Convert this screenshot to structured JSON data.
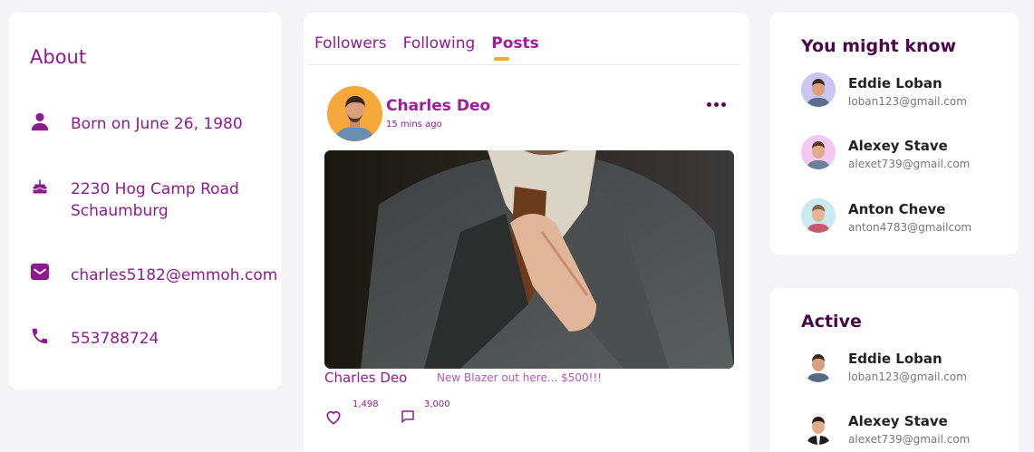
{
  "about": {
    "title": "About",
    "items": [
      {
        "icon": "person-icon",
        "text": "Born on June 26, 1980"
      },
      {
        "icon": "cake-icon",
        "text_line1": "2230 Hog Camp Road",
        "text_line2": "Schaumburg"
      },
      {
        "icon": "mail-icon",
        "text": "charles5182@emmoh.com"
      },
      {
        "icon": "phone-icon",
        "text": "553788724"
      }
    ]
  },
  "feed": {
    "tabs": [
      "Followers",
      "Following",
      "Posts"
    ],
    "active_tab": "Posts",
    "post": {
      "author": "Charles Deo",
      "time": "15 mins ago",
      "footer_author": "Charles Deo",
      "caption": "New Blazer out here... $500!!!",
      "likes": "1,498",
      "comments": "3,000"
    }
  },
  "you_might_know": {
    "title": "You might know",
    "people": [
      {
        "name": "Eddie Loban",
        "email": "loban123@gmail.com",
        "avatar_bg": "#c9c6f2"
      },
      {
        "name": "Alexey Stave",
        "email": "alexet739@gmail.com",
        "avatar_bg": "#f2c9f2"
      },
      {
        "name": "Anton Cheve",
        "email": "anton4783@gmailcom",
        "avatar_bg": "#c9eaf2"
      }
    ]
  },
  "active": {
    "title": "Active",
    "people": [
      {
        "name": "Eddie Loban",
        "email": "loban123@gmail.com"
      },
      {
        "name": "Alexey Stave",
        "email": "alexet739@gmail.com"
      }
    ]
  },
  "colors": {
    "accent": "#8e1b8e",
    "tab_underline": "#f3a93a",
    "heading_dark": "#4a0a4a",
    "background": "#f5f5f7"
  }
}
